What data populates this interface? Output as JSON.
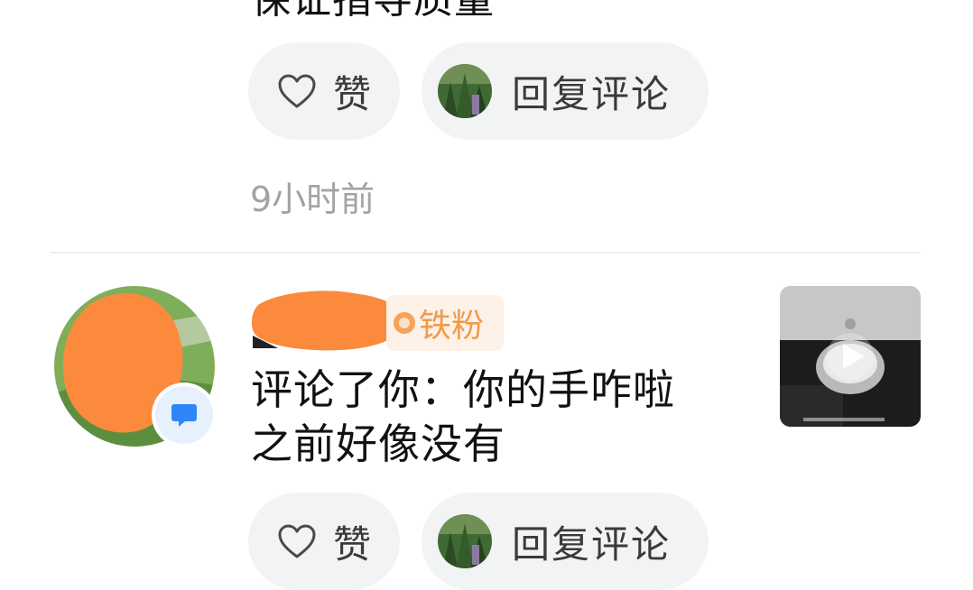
{
  "prev_item": {
    "text_partial": "保证指导质量",
    "like_label": "赞",
    "reply_label": "回复评论",
    "time": "9小时前"
  },
  "notification": {
    "badge_label": "铁粉",
    "comment_text_line1": "评论了你：你的手咋啦",
    "comment_text_line2": "之前好像没有",
    "like_label": "赞",
    "reply_label": "回复评论"
  },
  "icons": {
    "like": "heart-outline-icon",
    "chat": "chat-bubble-icon",
    "play": "play-icon"
  },
  "colors": {
    "pill_bg": "#f2f3f5",
    "fan_badge_text": "#f09a4c",
    "fan_badge_bg": "#fdf1e8",
    "time_text": "#a3a3a3",
    "chat_icon": "#2f86f6",
    "redaction": "#fb8a3c"
  }
}
